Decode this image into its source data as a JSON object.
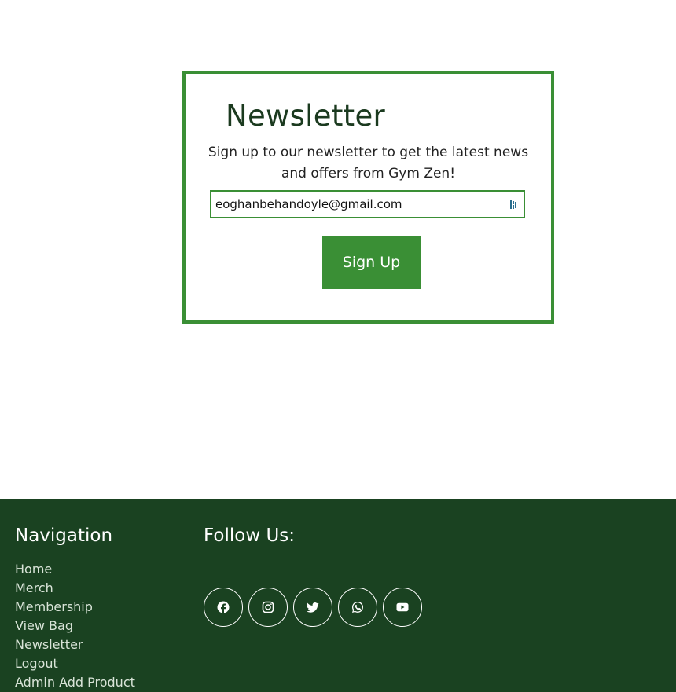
{
  "newsletter": {
    "title": "Newsletter",
    "description": "Sign up to our newsletter to get the latest news and offers from Gym Zen!",
    "email_value": "eoghanbehandoyle@gmail.com",
    "signup_label": "Sign Up"
  },
  "footer": {
    "navigation_title": "Navigation",
    "nav_items": [
      {
        "label": "Home"
      },
      {
        "label": "Merch"
      },
      {
        "label": "Membership"
      },
      {
        "label": "View Bag"
      },
      {
        "label": "Newsletter"
      },
      {
        "label": "Logout"
      },
      {
        "label": "Admin Add Product"
      }
    ],
    "follow_title": "Follow Us:",
    "social_icons": [
      "facebook-icon",
      "instagram-icon",
      "twitter-icon",
      "whatsapp-icon",
      "youtube-icon"
    ]
  },
  "colors": {
    "brand_green": "#3a8f35",
    "footer_bg": "#1a4221",
    "title_text": "#1b3a1f"
  }
}
